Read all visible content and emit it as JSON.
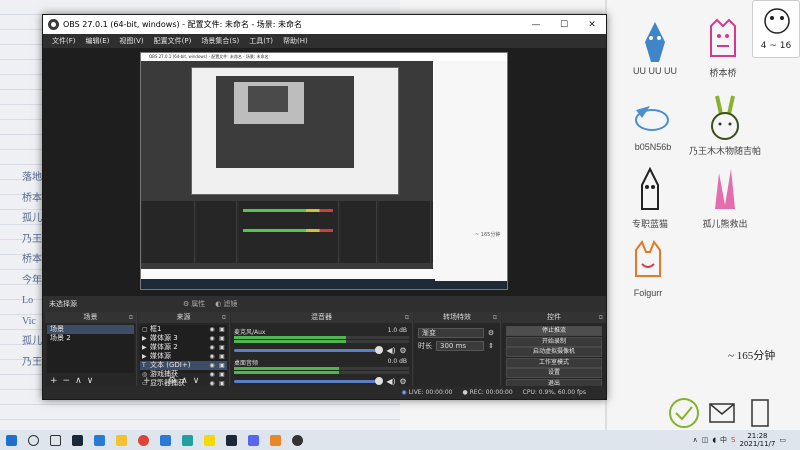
{
  "colors": {
    "obs_bg": "#2b2b2b",
    "dock_header": "#333333",
    "selected": "#3d4d66",
    "accent_blue": "#5b7fc0",
    "taskbar": "#dfe5ec"
  },
  "background_left": {
    "list": [
      "落地",
      "桥本",
      "孤儿",
      "乃王",
      "桥本",
      "今年",
      "Lo",
      "Vic",
      "孤儿",
      "乃王"
    ]
  },
  "background_right": {
    "stickers": [
      {
        "label": "UU UU UU",
        "icon": "blue-chick-icon"
      },
      {
        "label": "桥本桥",
        "icon": "pink-face-icon"
      },
      {
        "label": "b05N56b",
        "icon": "blue-fish-icon"
      },
      {
        "label": "乃王木木物随吉帕",
        "icon": "green-bunny-icon"
      },
      {
        "label": "专职蓝猫",
        "icon": "black-bird-icon"
      },
      {
        "label": "孤儿熊救出",
        "icon": "pink-crystal-icon"
      },
      {
        "label": "Folgurr",
        "icon": "orange-cat-icon"
      }
    ],
    "clock_note": "~ 165分钟",
    "frog_badge": "4 ~ 16"
  },
  "obs": {
    "title": "OBS 27.0.1 (64-bit, windows) - 配置文件: 未命名 - 场景: 未命名",
    "menu": [
      "文件(F)",
      "编辑(E)",
      "视图(V)",
      "配置文件(P)",
      "场景集合(S)",
      "工具(T)",
      "帮助(H)"
    ],
    "window_controls": {
      "min": "—",
      "max": "☐",
      "close": "✕"
    },
    "no_source": "未选择源",
    "strip": {
      "properties": "属性",
      "filters": "滤镜"
    },
    "preview_title": "OBS 27.0.1 (64-bit, windows) - 配置文件: 未命名 - 场景: 未命名",
    "preview_right_note": "~ 165分钟",
    "docks": {
      "scenes": {
        "title": "场景",
        "items": [
          "场景",
          "场景 2"
        ]
      },
      "sources": {
        "title": "来源",
        "items": [
          {
            "icon": "▢",
            "name": "框1"
          },
          {
            "icon": "▶",
            "name": "媒体源 3"
          },
          {
            "icon": "▶",
            "name": "媒体源 2"
          },
          {
            "icon": "▶",
            "name": "媒体源"
          },
          {
            "icon": "T",
            "name": "文本 (GDI+)"
          },
          {
            "icon": "◎",
            "name": "游戏捕获"
          },
          {
            "icon": "▭",
            "name": "显示器捕获"
          }
        ]
      },
      "mixer": {
        "title": "混音器",
        "tracks": [
          {
            "name": "麦克风/Aux",
            "db": "1.0 dB",
            "level": 0.64
          },
          {
            "name": "桌面音频",
            "db": "0.0 dB",
            "level": 0.6
          }
        ]
      },
      "transitions": {
        "title": "转场特效",
        "type": "渐变",
        "duration_label": "时长",
        "duration": "300 ms"
      },
      "controls": {
        "title": "控件",
        "buttons": [
          "停止推流",
          "开始录制",
          "启动虚拟摄像机",
          "工作室模式",
          "设置",
          "退出"
        ]
      }
    },
    "statusbar": {
      "live": "LIVE: 00:00:00",
      "rec": "REC: 00:00:00",
      "cpu": "CPU: 0.9%, 60.00 fps"
    }
  },
  "taskbar": {
    "icons": [
      "windows-start-icon",
      "search-icon",
      "task-view-icon",
      "steam-icon",
      "store-icon",
      "file-explorer-icon",
      "chrome-icon",
      "mail-icon",
      "app-icon",
      "sticky-icon",
      "steam-icon",
      "discord-icon",
      "orange-app-icon",
      "obs-icon"
    ],
    "time": "21:28",
    "date": "2021/11/7",
    "tray_lang": "中"
  }
}
